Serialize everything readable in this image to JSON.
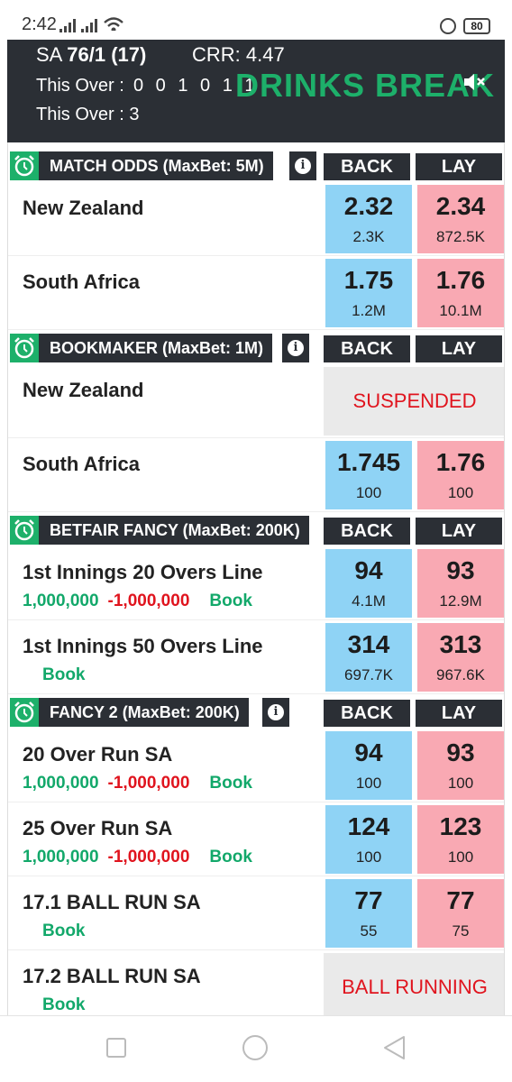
{
  "status_bar": {
    "time": "2:42",
    "battery": "80"
  },
  "score": {
    "team": "SA",
    "runs": "76/1",
    "overs": "(17)",
    "crr": "CRR: 4.47",
    "this_over_label": "This Over :",
    "this_over_balls": "0 0 1 0 1 1 -",
    "drinks": "DRINKS BREAK",
    "this_over_runs": "This Over : 3"
  },
  "markets": [
    {
      "title": "MATCH ODDS (MaxBet: 5M)",
      "back_label": "BACK",
      "lay_label": "LAY",
      "rows": [
        {
          "name": "New Zealand",
          "back": "2.32",
          "back_vol": "2.3K",
          "lay": "2.34",
          "lay_vol": "872.5K"
        },
        {
          "name": "South Africa",
          "back": "1.75",
          "back_vol": "1.2M",
          "lay": "1.76",
          "lay_vol": "10.1M"
        }
      ]
    },
    {
      "title": "BOOKMAKER (MaxBet: 1M)",
      "back_label": "BACK",
      "lay_label": "LAY",
      "rows": [
        {
          "name": "New Zealand",
          "status": "SUSPENDED"
        },
        {
          "name": "South Africa",
          "back": "1.745",
          "back_vol": "100",
          "lay": "1.76",
          "lay_vol": "100"
        }
      ]
    },
    {
      "title": "BETFAIR FANCY (MaxBet: 200K)",
      "back_label": "BACK",
      "lay_label": "LAY",
      "rows": [
        {
          "name": "1st Innings 20 Overs Line",
          "pos": "1,000,000",
          "neg": "-1,000,000",
          "book": "Book",
          "back": "94",
          "back_vol": "4.1M",
          "lay": "93",
          "lay_vol": "12.9M"
        },
        {
          "name": "1st Innings 50 Overs Line",
          "book": "Book",
          "back": "314",
          "back_vol": "697.7K",
          "lay": "313",
          "lay_vol": "967.6K"
        }
      ]
    },
    {
      "title": "FANCY 2 (MaxBet: 200K)",
      "back_label": "BACK",
      "lay_label": "LAY",
      "rows": [
        {
          "name": "20 Over Run SA",
          "pos": "1,000,000",
          "neg": "-1,000,000",
          "book": "Book",
          "back": "94",
          "back_vol": "100",
          "lay": "93",
          "lay_vol": "100"
        },
        {
          "name": "25 Over Run SA",
          "pos": "1,000,000",
          "neg": "-1,000,000",
          "book": "Book",
          "back": "124",
          "back_vol": "100",
          "lay": "123",
          "lay_vol": "100"
        },
        {
          "name": "17.1 BALL RUN SA",
          "book": "Book",
          "back": "77",
          "back_vol": "55",
          "lay": "77",
          "lay_vol": "75"
        },
        {
          "name": "17.2 BALL RUN SA",
          "book": "Book",
          "status": "BALL RUNNING"
        }
      ]
    }
  ]
}
